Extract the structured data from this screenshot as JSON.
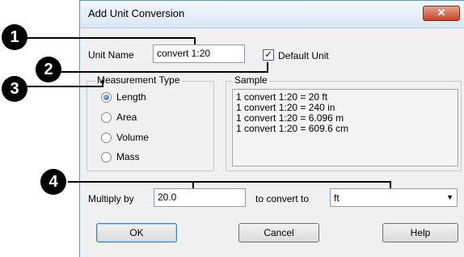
{
  "dialog": {
    "title": "Add Unit Conversion",
    "close_label": "✕"
  },
  "unit_name": {
    "label": "Unit Name",
    "value": "convert 1:20"
  },
  "default_unit": {
    "label": "Default Unit",
    "checked": true,
    "check_mark": "✓"
  },
  "measurement_type": {
    "title": "Measurement Type",
    "options": [
      {
        "label": "Length",
        "selected": true
      },
      {
        "label": "Area",
        "selected": false
      },
      {
        "label": "Volume",
        "selected": false
      },
      {
        "label": "Mass",
        "selected": false
      }
    ]
  },
  "sample": {
    "title": "Sample",
    "lines": [
      "1 convert 1:20 = 20 ft",
      "1 convert 1:20 = 240 in",
      "1 convert 1:20 = 6.096 m",
      "1 convert 1:20 = 609.6 cm"
    ]
  },
  "multiply": {
    "label": "Multiply by",
    "value": "20.0"
  },
  "convert_to": {
    "label": "to convert to",
    "value": "ft",
    "arrow": "▼"
  },
  "buttons": {
    "ok": "OK",
    "cancel": "Cancel",
    "help": "Help"
  },
  "callouts": [
    "1",
    "2",
    "3",
    "4"
  ]
}
